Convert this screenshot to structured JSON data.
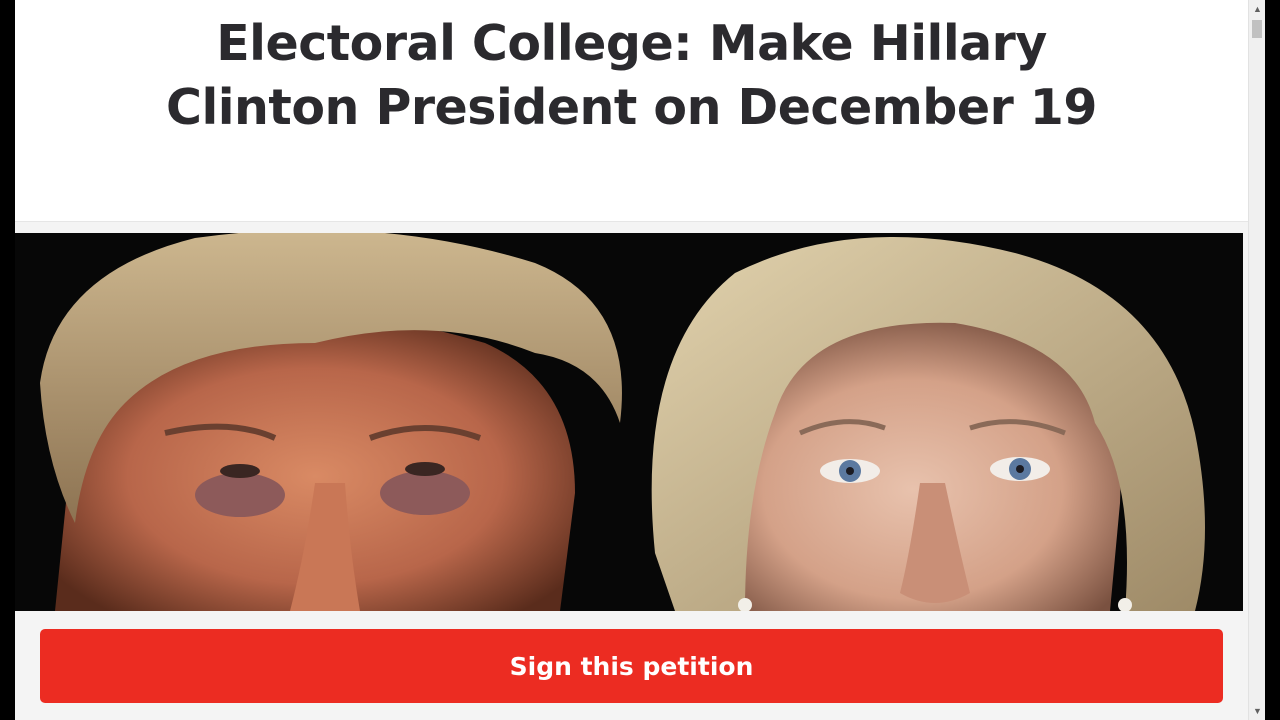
{
  "petition": {
    "title": "Electoral College: Make Hillary Clinton President on December 19",
    "sign_button_label": "Sign this petition"
  },
  "scrollbar": {
    "up_arrow": "▲",
    "down_arrow": "▼"
  },
  "colors": {
    "accent": "#ec2c22",
    "title_text": "#2b2a2e",
    "page_background": "#f4f4f4"
  },
  "icons": {
    "scroll_up": "scroll-up-arrow-icon",
    "scroll_down": "scroll-down-arrow-icon"
  }
}
